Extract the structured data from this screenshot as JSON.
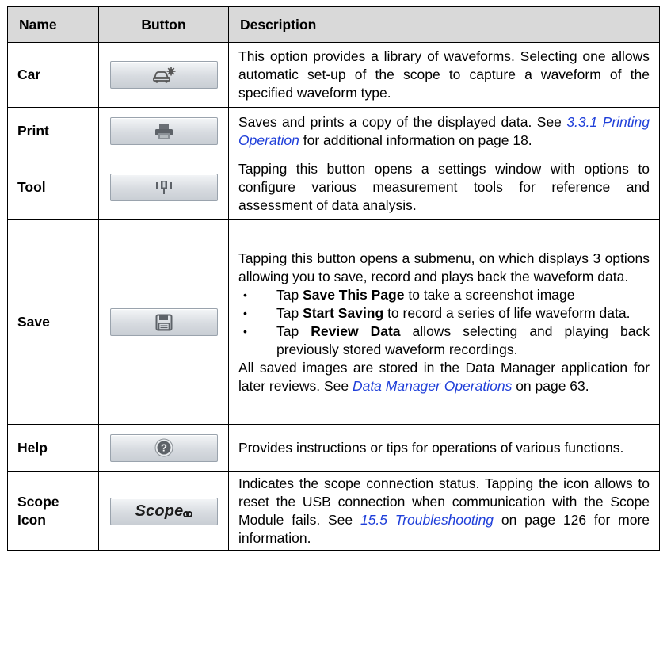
{
  "headers": {
    "name": "Name",
    "button": "Button",
    "description": "Description"
  },
  "rows": [
    {
      "name": "Car",
      "icon": "car-settings-icon",
      "desc": [
        "This option provides a library of waveforms. Selecting one allows automatic set-up of the scope to capture a waveform of the specified waveform type."
      ]
    },
    {
      "name": "Print",
      "icon": "printer-icon",
      "desc": [
        "Saves and prints a copy of the displayed data. See ",
        "3.3.1 Printing Operation",
        " for additional information on page 18."
      ]
    },
    {
      "name": "Tool",
      "icon": "tool-icon",
      "desc": [
        "Tapping this button opens a settings window with options to configure various measurement tools for reference and assessment of data analysis."
      ]
    },
    {
      "name": "Save",
      "icon": "floppy-disk-icon",
      "intro": "Tapping this button opens a submenu, on which displays 3 options allowing you to save, record and plays back the waveform data.",
      "bullets": [
        {
          "pre": "Tap ",
          "bold": "Save This Page",
          "post": " to take a screenshot image"
        },
        {
          "pre": "Tap ",
          "bold": "Start Saving",
          "post": " to record a series of life waveform data."
        },
        {
          "pre": "Tap ",
          "bold": "Review Data",
          "post": " allows selecting and playing back previously stored waveform recordings."
        }
      ],
      "outro": [
        "All saved images are stored in the Data Manager application for later reviews. See ",
        "Data Manager Operations",
        " on page 63."
      ]
    },
    {
      "name": "Help",
      "icon": "help-icon",
      "desc": [
        "Provides instructions or tips for operations of various functions."
      ]
    },
    {
      "name": "Scope Icon",
      "icon": "scope-logo-icon",
      "logo_text": "Scope",
      "desc": [
        "Indicates the scope connection status. Tapping the icon allows to reset the USB connection when communication with the Scope Module fails. See ",
        "15.5 Troubleshooting",
        " on page 126 for more information."
      ]
    }
  ],
  "colors": {
    "header_bg": "#d9d9d9",
    "link": "#1f3fd9",
    "button_border": "#9aa3ad"
  }
}
